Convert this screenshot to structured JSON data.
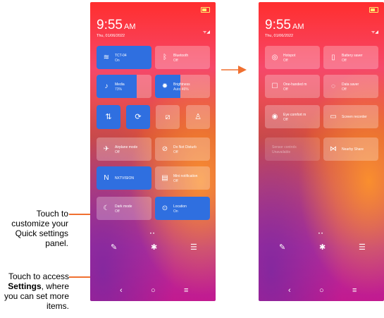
{
  "status": {
    "time": "9:55",
    "ampm": "AM",
    "date": "Thu, 01/06/2022",
    "battery": "80"
  },
  "panel1": {
    "wifi": {
      "title": "TCT-04",
      "state": "On"
    },
    "bluetooth": {
      "title": "Bluetooth",
      "state": "Off"
    },
    "media": {
      "title": "Media",
      "state": "73%",
      "level": 0.73
    },
    "brightness": {
      "title": "Brightness",
      "state": "Auto 46%",
      "level": 0.46
    },
    "airplane": {
      "title": "Airplane mode",
      "state": "Off"
    },
    "dnd": {
      "title": "Do Not Disturb",
      "state": "Off"
    },
    "nxtvision": {
      "title": "NXTVISION"
    },
    "mininotif": {
      "title": "Mini notification",
      "state": "Off"
    },
    "darkmode": {
      "title": "Dark mode",
      "state": "Off"
    },
    "location": {
      "title": "Location",
      "state": "On"
    }
  },
  "panel2": {
    "hotspot": {
      "title": "Hotspot",
      "state": "Off"
    },
    "batterysaver": {
      "title": "Battery saver",
      "state": "Off"
    },
    "onehanded": {
      "title": "One-handed m",
      "state": "Off"
    },
    "datasaver": {
      "title": "Data saver",
      "state": "Off"
    },
    "eyecomfort": {
      "title": "Eye comfort m",
      "state": "Off"
    },
    "screenrecorder": {
      "title": "Screen recorder"
    },
    "faded": {
      "title": "Sensor controls",
      "state": "Unavailable"
    },
    "nearby": {
      "title": "Nearby Share"
    }
  },
  "callouts": {
    "edit": "Touch to customize your Quick settings panel.",
    "settings_pre": "Touch to access",
    "settings_bold": "Settings",
    "settings_post": ", where you can set more items."
  },
  "icons": [
    "wifi-icon",
    "bluetooth-icon",
    "music-icon",
    "brightness-icon",
    "data-arrows-icon",
    "rotate-icon",
    "screenshot-icon",
    "flashlight-icon",
    "airplane-icon",
    "dnd-icon",
    "nxtvision-icon",
    "mini-notification-icon",
    "dark-mode-icon",
    "location-icon",
    "hotspot-icon",
    "battery-icon",
    "one-handed-icon",
    "data-saver-icon",
    "eye-icon",
    "screen-recorder-icon",
    "nearby-share-icon",
    "edit-pencil-icon",
    "gear-icon",
    "notification-settings-icon",
    "back-icon",
    "home-icon",
    "recents-icon"
  ],
  "colors": {
    "accent": "#2f6fe0",
    "callout_line": "#f07030"
  }
}
